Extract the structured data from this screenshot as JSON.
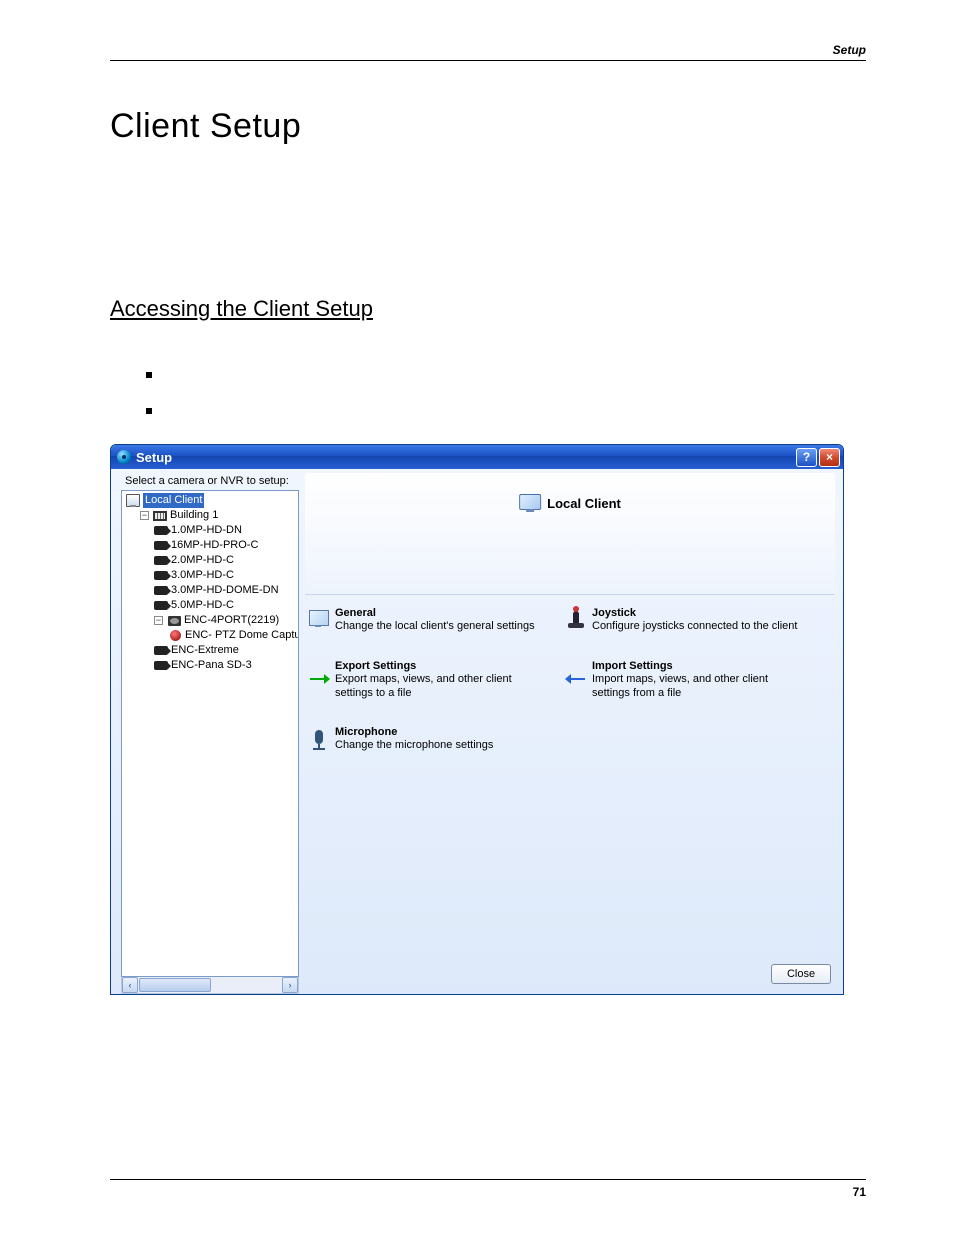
{
  "header": {
    "right": "Setup"
  },
  "title": "Client Setup",
  "section": "Accessing the Client Setup",
  "page_number": "71",
  "window": {
    "title": "Setup",
    "tree": {
      "caption": "Select a camera or NVR to setup:",
      "root": {
        "label": "Local Client",
        "children": [
          {
            "label": "Building 1",
            "children": [
              {
                "label": "1.0MP-HD-DN"
              },
              {
                "label": "16MP-HD-PRO-C"
              },
              {
                "label": "2.0MP-HD-C"
              },
              {
                "label": "3.0MP-HD-C"
              },
              {
                "label": "3.0MP-HD-DOME-DN"
              },
              {
                "label": "5.0MP-HD-C"
              },
              {
                "label": "ENC-4PORT(2219)",
                "children": [
                  {
                    "label": "ENC- PTZ Dome Captu"
                  }
                ]
              },
              {
                "label": "ENC-Extreme"
              },
              {
                "label": "ENC-Pana SD-3"
              }
            ]
          }
        ]
      }
    },
    "content": {
      "header_title": "Local Client",
      "options": [
        {
          "title": "General",
          "desc": "Change the local client's general settings"
        },
        {
          "title": "Joystick",
          "desc": "Configure joysticks connected to the client"
        },
        {
          "title": "Export Settings",
          "desc": "Export maps, views, and other client settings to a file"
        },
        {
          "title": "Import Settings",
          "desc": "Import maps, views, and other client settings from a file"
        },
        {
          "title": "Microphone",
          "desc": "Change the microphone settings"
        }
      ]
    },
    "close_label": "Close"
  }
}
